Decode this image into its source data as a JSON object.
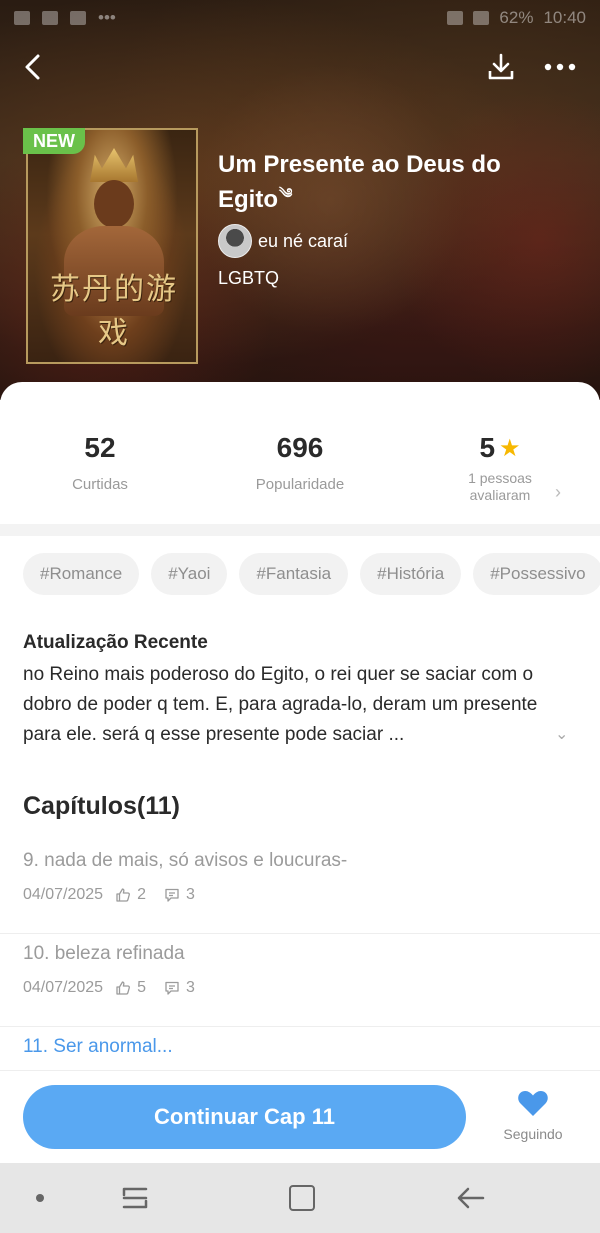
{
  "status_bar": {
    "battery": "62%",
    "time": "10:40"
  },
  "nav": {
    "back_icon": "back-arrow-icon",
    "download_icon": "download-icon",
    "more_icon": "more-dots-icon"
  },
  "book": {
    "badge": "NEW",
    "cover_title": "苏丹的游戏",
    "title": "Um Presente ao Deus do Egito",
    "author": "eu né caraí",
    "genre": "LGBTQ"
  },
  "stats": {
    "likes_value": "52",
    "likes_label": "Curtidas",
    "popularity_value": "696",
    "popularity_label": "Popularidade",
    "rating_value": "5",
    "rating_label": "1 pessoas avaliaram"
  },
  "tags": [
    "#Romance",
    "#Yaoi",
    "#Fantasia",
    "#História",
    "#Possessivo"
  ],
  "update": {
    "heading": "Atualização Recente",
    "text": "no Reino mais poderoso do Egito, o rei quer se saciar com o dobro de poder q tem. E, para agrada-lo, deram um presente para ele. será q esse presente pode saciar ..."
  },
  "chapters": {
    "heading": "Capítulos(11)",
    "items": [
      {
        "title": "9. nada de mais, só avisos e loucuras-",
        "date": "04/07/2025",
        "likes": "2",
        "comments": "3"
      },
      {
        "title": "10. beleza refinada",
        "date": "04/07/2025",
        "likes": "5",
        "comments": "3"
      }
    ],
    "current": "11. Ser anormal..."
  },
  "actions": {
    "continue_label": "Continuar Cap 11",
    "follow_label": "Seguindo"
  },
  "colors": {
    "accent": "#5aa9f3",
    "link": "#4a98ea",
    "badge": "#6ac14a",
    "star": "#f7b801"
  }
}
